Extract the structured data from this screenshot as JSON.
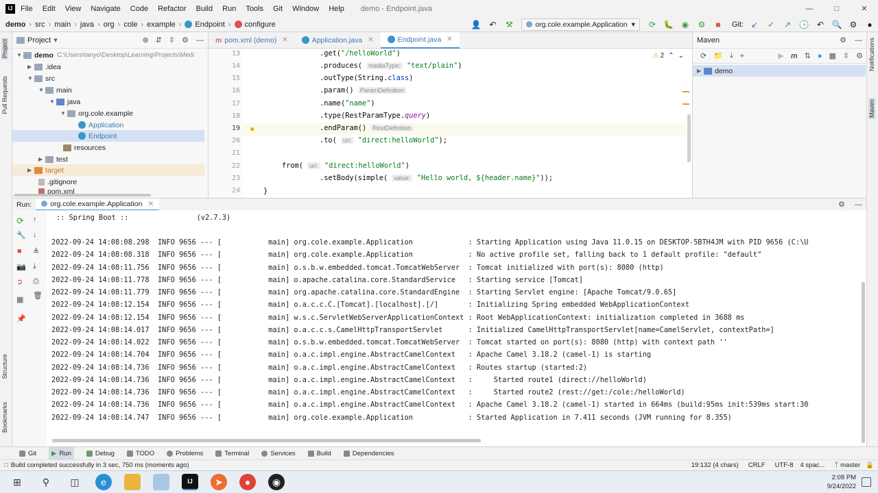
{
  "menubar": {
    "items": [
      "File",
      "Edit",
      "View",
      "Navigate",
      "Code",
      "Refactor",
      "Build",
      "Run",
      "Tools",
      "Git",
      "Window",
      "Help"
    ],
    "title": "demo - Endpoint.java"
  },
  "breadcrumb": [
    "demo",
    "src",
    "main",
    "java",
    "org",
    "cole",
    "example",
    "Endpoint",
    "configure"
  ],
  "toolbar": {
    "run_config": "org.cole.example.Application",
    "git_label": "Git:"
  },
  "left_strip": {
    "project": "Project",
    "pull_requests": "Pull Requests",
    "structure": "Structure",
    "bookmarks": "Bookmarks"
  },
  "right_strip": {
    "notifications": "Notifications",
    "maven": "Maven"
  },
  "project": {
    "title": "Project",
    "tree": [
      {
        "label": "demo",
        "path": "C:\\Users\\tanyo\\Desktop\\Learning\\Projects\\Medi"
      },
      {
        "label": ".idea"
      },
      {
        "label": "src"
      },
      {
        "label": "main"
      },
      {
        "label": "java"
      },
      {
        "label": "org.cole.example"
      },
      {
        "label": "Application"
      },
      {
        "label": "Endpoint"
      },
      {
        "label": "resources"
      },
      {
        "label": "test"
      },
      {
        "label": "target"
      },
      {
        "label": ".gitignore"
      },
      {
        "label": "pom.xml"
      }
    ]
  },
  "editor": {
    "tabs": [
      {
        "label": "pom.xml (demo)"
      },
      {
        "label": "Application.java"
      },
      {
        "label": "Endpoint.java"
      }
    ],
    "warnings": "2",
    "lines": [
      "13",
      "14",
      "15",
      "16",
      "17",
      "18",
      "19",
      "20",
      "21",
      "22",
      "23",
      "24"
    ],
    "code": {
      "l13a": ".get(",
      "l13b": "\"/helloWorld\"",
      "l13c": ")",
      "l14a": ".produces(",
      "l14h": "mediaType:",
      "l14b": "\"text/plain\"",
      "l14c": ")",
      "l15a": ".outType(String.",
      "l15k": "class",
      "l15c": ")",
      "l16a": ".param()",
      "l16h": "ParamDefinition",
      "l17a": ".name(",
      "l17b": "\"name\"",
      "l17c": ")",
      "l18a": ".type(RestParamType.",
      "l18i": "query",
      "l18c": ")",
      "l19a": ".endParam()",
      "l19h": "RestDefinition",
      "l20a": ".to(",
      "l20h": "uri:",
      "l20b": "\"direct:helloWorld\"",
      "l20c": ");",
      "l22a": "from(",
      "l22h": "uri:",
      "l22b": "\"direct:helloWorld\"",
      "l22c": ")",
      "l23a": ".setBody(simple(",
      "l23h": "value:",
      "l23b": "\"Hello world, ${header.name}\"",
      "l23c": "));",
      "l24a": "}"
    }
  },
  "maven": {
    "title": "Maven",
    "project": "demo"
  },
  "run": {
    "label": "Run:",
    "tab": "org.cole.example.Application",
    "spring_banner": ":: Spring Boot ::                (v2.7.3)",
    "log": [
      "2022-09-24 14:08:08.298  INFO 9656 --- [           main] org.cole.example.Application             : Starting Application using Java 11.0.15 on DESKTOP-5BTH4JM with PID 9656 (C:\\U",
      "2022-09-24 14:08:08.318  INFO 9656 --- [           main] org.cole.example.Application             : No active profile set, falling back to 1 default profile: \"default\"",
      "2022-09-24 14:08:11.756  INFO 9656 --- [           main] o.s.b.w.embedded.tomcat.TomcatWebServer  : Tomcat initialized with port(s): 8080 (http)",
      "2022-09-24 14:08:11.778  INFO 9656 --- [           main] o.apache.catalina.core.StandardService   : Starting service [Tomcat]",
      "2022-09-24 14:08:11.779  INFO 9656 --- [           main] org.apache.catalina.core.StandardEngine  : Starting Servlet engine: [Apache Tomcat/9.0.65]",
      "2022-09-24 14:08:12.154  INFO 9656 --- [           main] o.a.c.c.C.[Tomcat].[localhost].[/]       : Initializing Spring embedded WebApplicationContext",
      "2022-09-24 14:08:12.154  INFO 9656 --- [           main] w.s.c.ServletWebServerApplicationContext : Root WebApplicationContext: initialization completed in 3688 ms",
      "2022-09-24 14:08:14.017  INFO 9656 --- [           main] o.a.c.c.s.CamelHttpTransportServlet      : Initialized CamelHttpTransportServlet[name=CamelServlet, contextPath=]",
      "2022-09-24 14:08:14.022  INFO 9656 --- [           main] o.s.b.w.embedded.tomcat.TomcatWebServer  : Tomcat started on port(s): 8080 (http) with context path ''",
      "2022-09-24 14:08:14.704  INFO 9656 --- [           main] o.a.c.impl.engine.AbstractCamelContext   : Apache Camel 3.18.2 (camel-1) is starting",
      "2022-09-24 14:08:14.736  INFO 9656 --- [           main] o.a.c.impl.engine.AbstractCamelContext   : Routes startup (started:2)",
      "2022-09-24 14:08:14.736  INFO 9656 --- [           main] o.a.c.impl.engine.AbstractCamelContext   :     Started route1 (direct://helloWorld)",
      "2022-09-24 14:08:14.736  INFO 9656 --- [           main] o.a.c.impl.engine.AbstractCamelContext   :     Started route2 (rest://get:/cole:/helloWorld)",
      "2022-09-24 14:08:14.736  INFO 9656 --- [           main] o.a.c.impl.engine.AbstractCamelContext   : Apache Camel 3.18.2 (camel-1) started in 664ms (build:95ms init:539ms start:30",
      "2022-09-24 14:08:14.747  INFO 9656 --- [           main] org.cole.example.Application             : Started Application in 7.411 seconds (JVM running for 8.355)"
    ]
  },
  "bottom_tabs": [
    "Git",
    "Run",
    "Debug",
    "TODO",
    "Problems",
    "Terminal",
    "Services",
    "Build",
    "Dependencies"
  ],
  "status": {
    "message": "Build completed successfully in 3 sec, 750 ms (moments ago)",
    "position": "19:132 (4 chars)",
    "line_sep": "CRLF",
    "encoding": "UTF-8",
    "indent": "4 spac...",
    "branch": "master"
  },
  "taskbar": {
    "time": "2:08 PM",
    "date": "9/24/2022"
  },
  "colors": {
    "accent": "#4a8fd9",
    "selection": "#d5e1f2",
    "string": "#067d17",
    "run_green": "#3e9b45"
  }
}
